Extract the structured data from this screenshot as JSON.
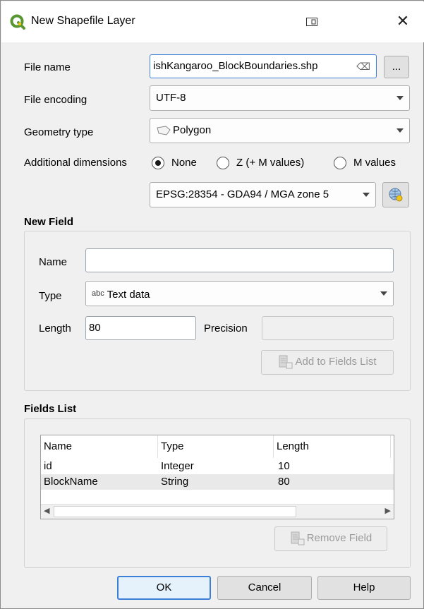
{
  "window": {
    "title": "New Shapefile Layer"
  },
  "form": {
    "file_name_label": "File name",
    "file_name_value": "ishKangaroo_BlockBoundaries.shp",
    "browse_label": "...",
    "file_encoding_label": "File encoding",
    "file_encoding_value": "UTF-8",
    "geometry_type_label": "Geometry type",
    "geometry_type_value": "Polygon",
    "additional_dimensions_label": "Additional dimensions",
    "dim_options": [
      "None",
      "Z (+ M values)",
      "M values"
    ],
    "dim_selected": "None",
    "crs_value": "EPSG:28354 - GDA94 / MGA zone 5"
  },
  "new_field": {
    "title": "New Field",
    "name_label": "Name",
    "name_value": "",
    "type_label": "Type",
    "type_prefix": "abc",
    "type_value": "Text data",
    "length_label": "Length",
    "length_value": "80",
    "precision_label": "Precision",
    "precision_value": "",
    "add_button": "Add to Fields List"
  },
  "fields_list": {
    "title": "Fields List",
    "columns": [
      "Name",
      "Type",
      "Length"
    ],
    "rows": [
      {
        "name": "id",
        "type": "Integer",
        "length": "10"
      },
      {
        "name": "BlockName",
        "type": "String",
        "length": "80"
      }
    ],
    "remove_button": "Remove Field"
  },
  "buttons": {
    "ok": "OK",
    "cancel": "Cancel",
    "help": "Help"
  },
  "colors": {
    "qgis_green": "#589632",
    "qgis_yellow": "#f0c419",
    "default_border": "#3c7fd8"
  }
}
